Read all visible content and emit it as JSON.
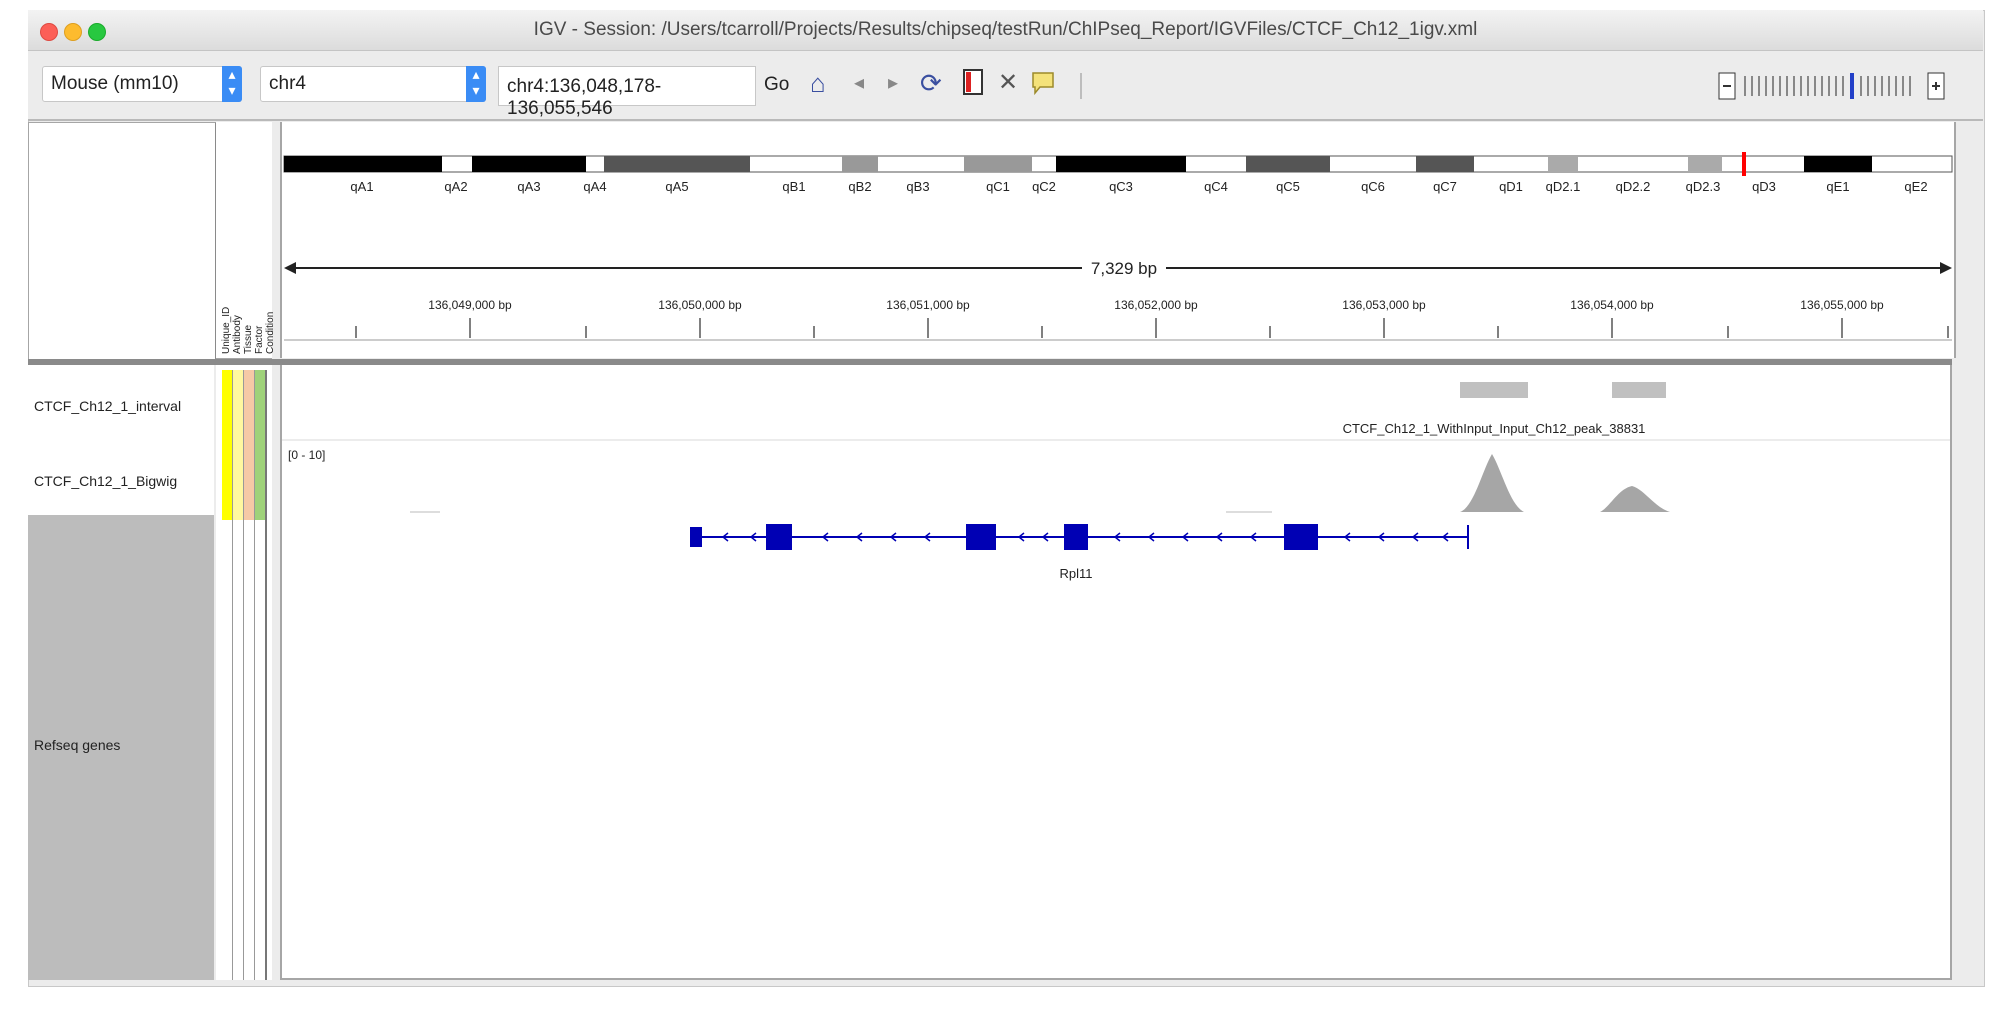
{
  "window": {
    "title": "IGV - Session: /Users/tcarroll/Projects/Results/chipseq/testRun/ChIPseq_Report/IGVFiles/CTCF_Ch12_1igv.xml"
  },
  "toolbar": {
    "genome": "Mouse (mm10)",
    "chromosome": "chr4",
    "locus": "chr4:136,048,178-136,055,546",
    "go_label": "Go"
  },
  "ideogram": {
    "bands": [
      "qA1",
      "qA2",
      "qA3",
      "qA4",
      "qA5",
      "qB1",
      "qB2",
      "qB3",
      "qC1",
      "qC2",
      "qC3",
      "qC4",
      "qC5",
      "qC6",
      "qC7",
      "qD1",
      "qD2.1",
      "qD2.2",
      "qD2.3",
      "qD3",
      "qE1",
      "qE2"
    ]
  },
  "ruler": {
    "span": "7,329 bp",
    "ticks": [
      "136,049,000 bp",
      "136,050,000 bp",
      "136,051,000 bp",
      "136,052,000 bp",
      "136,053,000 bp",
      "136,054,000 bp",
      "136,055,000 bp"
    ]
  },
  "attributes": {
    "headers": [
      "Unique_ID",
      "Antibody",
      "Tissue",
      "Factor",
      "Condition"
    ],
    "colors": [
      "#ffff00",
      "#fff8a0",
      "#f6c9a6",
      "#9fd27a"
    ]
  },
  "tracks": {
    "interval": {
      "name": "CTCF_Ch12_1_interval",
      "feature_label": "CTCF_Ch12_1_WithInput_Input_Ch12_peak_38831"
    },
    "bigwig": {
      "name": "CTCF_Ch12_1_Bigwig",
      "range": "[0 - 10]"
    },
    "refseq": {
      "name": "Refseq genes",
      "gene_label": "Rpl11"
    }
  },
  "colors": {
    "gene": "#0000b4",
    "coverage": "#a6a6a6",
    "interval": "#c0c0c0",
    "ideogram_marker": "#ff0000"
  }
}
